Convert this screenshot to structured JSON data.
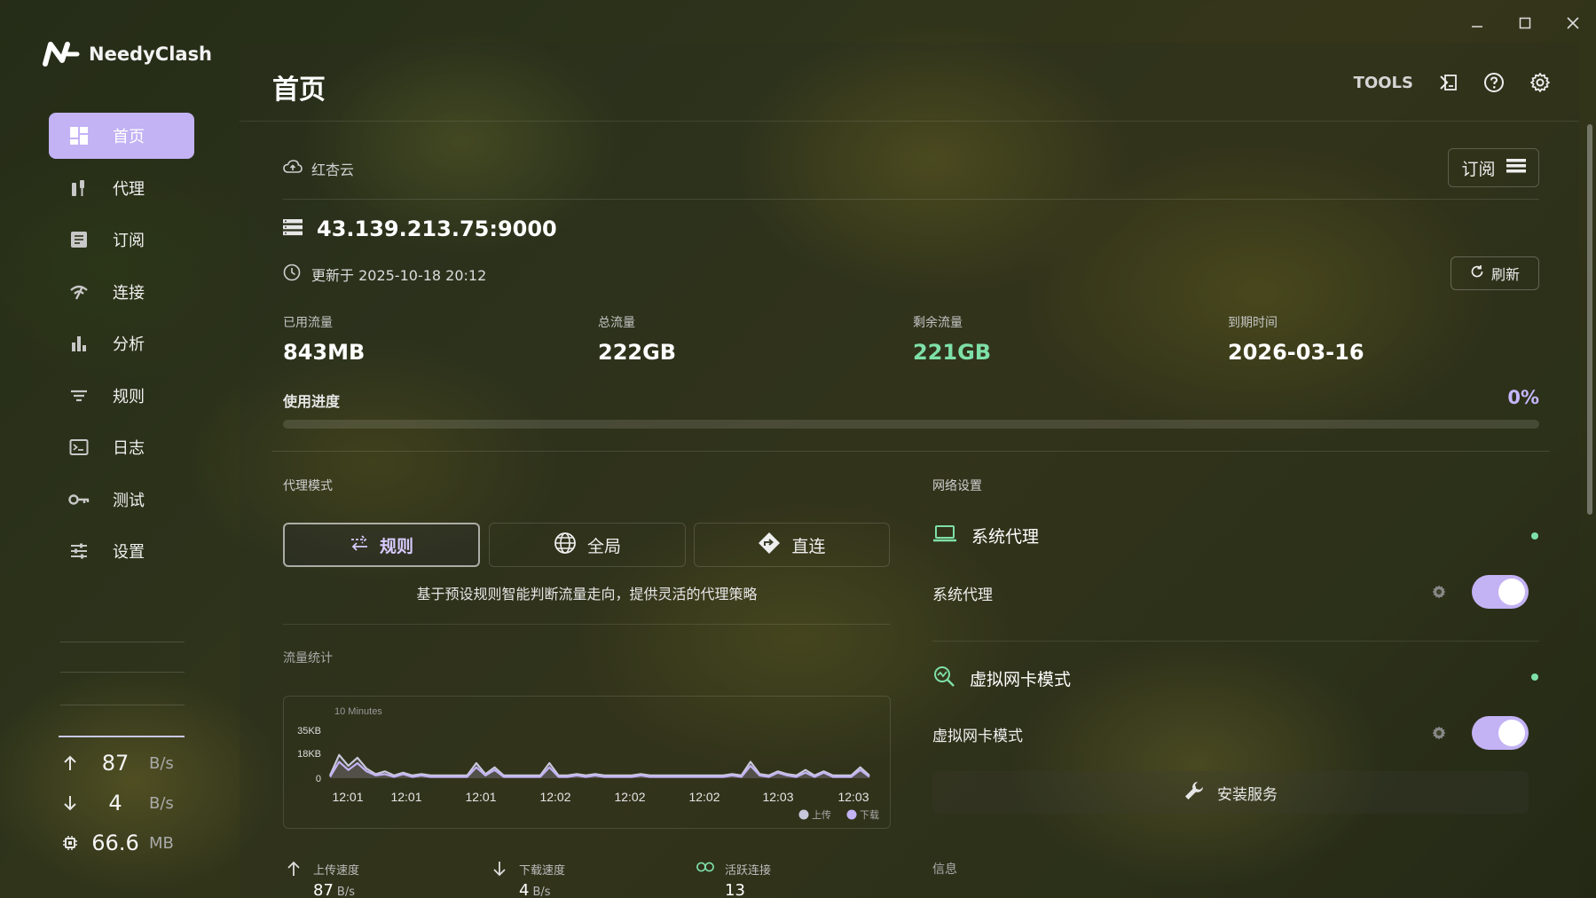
{
  "app": {
    "name": "NeedyClash",
    "page_title": "首页",
    "tools_label": "TOOLS"
  },
  "sidebar": {
    "items": [
      {
        "label": "首页",
        "icon": "dashboard-icon",
        "active": true
      },
      {
        "label": "代理",
        "icon": "proxy-icon"
      },
      {
        "label": "订阅",
        "icon": "subscription-icon"
      },
      {
        "label": "连接",
        "icon": "connection-icon"
      },
      {
        "label": "分析",
        "icon": "bar-chart-icon"
      },
      {
        "label": "规则",
        "icon": "filter-icon"
      },
      {
        "label": "日志",
        "icon": "terminal-icon"
      },
      {
        "label": "测试",
        "icon": "key-icon"
      },
      {
        "label": "设置",
        "icon": "sliders-icon"
      }
    ],
    "traffic": {
      "upload": {
        "value": "87",
        "unit": "B/s"
      },
      "download": {
        "value": "4",
        "unit": "B/s"
      },
      "memory": {
        "value": "66.6",
        "unit": "MB"
      }
    }
  },
  "subscription": {
    "name": "红杏云",
    "button_label": "订阅",
    "server": "43.139.213.75:9000",
    "updated": "更新于 2025-10-18 20:12",
    "refresh_label": "刷新",
    "stats": [
      {
        "label": "已用流量",
        "value": "843MB"
      },
      {
        "label": "总流量",
        "value": "222GB"
      },
      {
        "label": "剩余流量",
        "value": "221GB"
      },
      {
        "label": "到期时间",
        "value": "2026-03-16"
      }
    ],
    "progress_label": "使用进度",
    "progress_text": "0%",
    "progress_value": 0
  },
  "proxy_mode": {
    "title": "代理模式",
    "modes": [
      {
        "label": "规则",
        "icon": "route-icon",
        "active": true
      },
      {
        "label": "全局",
        "icon": "globe-icon"
      },
      {
        "label": "直连",
        "icon": "direction-icon"
      }
    ],
    "description": "基于预设规则智能判断流量走向，提供灵活的代理策略"
  },
  "traffic_stats": {
    "title": "流量统计",
    "chart_data": {
      "type": "area",
      "title": "10 Minutes",
      "y_ticks": [
        "35KB",
        "18KB",
        "0"
      ],
      "ylim": [
        0,
        35
      ],
      "y_unit": "KB",
      "x_ticks": [
        "12:01",
        "12:01",
        "12:01",
        "12:02",
        "12:02",
        "12:02",
        "12:03",
        "12:03"
      ],
      "legend": [
        "上传",
        "下载"
      ],
      "series": [
        {
          "name": "上传",
          "color": "#c8c8dc",
          "values": [
            2,
            17,
            9,
            15,
            7,
            3,
            5,
            2,
            4,
            2,
            3,
            2,
            2,
            2,
            2,
            2,
            11,
            3,
            8,
            2,
            2,
            2,
            2,
            2,
            11,
            2,
            2,
            3,
            2,
            3,
            2,
            2,
            2,
            2,
            3,
            2,
            2,
            2,
            2,
            2,
            2,
            2,
            2,
            2,
            3,
            2,
            12,
            3,
            2,
            5,
            3,
            2,
            6,
            2,
            5,
            2,
            2,
            2,
            8,
            2
          ]
        },
        {
          "name": "下载",
          "color": "#c3b2f4",
          "values": [
            1,
            12,
            6,
            11,
            5,
            2,
            3,
            1,
            3,
            1,
            2,
            1,
            1,
            1,
            1,
            1,
            8,
            2,
            6,
            1,
            1,
            1,
            1,
            1,
            8,
            1,
            1,
            2,
            1,
            2,
            1,
            1,
            1,
            1,
            2,
            1,
            1,
            1,
            1,
            1,
            1,
            1,
            1,
            1,
            2,
            1,
            9,
            2,
            1,
            4,
            2,
            1,
            4,
            1,
            4,
            1,
            1,
            1,
            6,
            1
          ]
        }
      ]
    },
    "bottom": [
      {
        "label": "上传速度",
        "value": "87",
        "unit": "B/s",
        "icon": "arrow-up-icon"
      },
      {
        "label": "下载速度",
        "value": "4",
        "unit": "B/s",
        "icon": "arrow-down-icon"
      },
      {
        "label": "活跃连接",
        "value": "13",
        "unit": "",
        "icon": "link-icon"
      }
    ]
  },
  "network": {
    "title": "网络设置",
    "system_proxy": {
      "heading": "系统代理",
      "label": "系统代理",
      "enabled": true
    },
    "tun": {
      "heading": "虚拟网卡模式",
      "label": "虚拟网卡模式",
      "enabled": true
    },
    "install_label": "安装服务"
  },
  "info": {
    "title": "信息"
  },
  "colors": {
    "accent": "#c3b2f4",
    "green": "#7ee0a8"
  }
}
